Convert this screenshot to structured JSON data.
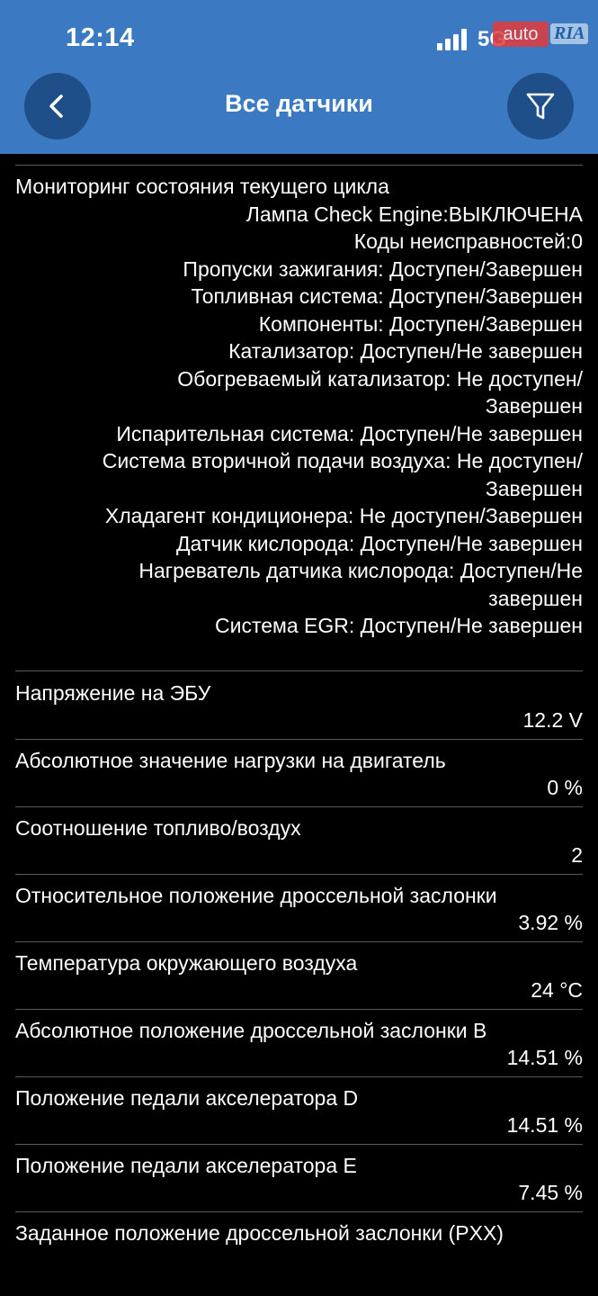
{
  "status_bar": {
    "time": "12:14",
    "network": "5G",
    "watermark_auto": "auto",
    "watermark_ria": "RIA"
  },
  "header": {
    "title": "Все датчики",
    "back_icon": "chevron-left-icon",
    "filter_icon": "filter-icon",
    "color": "#3b7ac2"
  },
  "monitor": {
    "title": "Мониторинг состояния текущего цикла",
    "lines": [
      "Лампа Check Engine:ВЫКЛЮЧЕНА",
      "Коды неисправностей:0",
      "Пропуски зажигания: Доступен/Завершен",
      "Топливная система: Доступен/Завершен",
      "Компоненты: Доступен/Завершен",
      "Катализатор: Доступен/Не завершен",
      "Обогреваемый катализатор: Не доступен/",
      "Завершен",
      "Испарительная система: Доступен/Не завершен",
      "Система вторичной подачи воздуха: Не доступен/",
      "Завершен",
      "Хладагент кондиционера: Не доступен/Завершен",
      "Датчик кислорода: Доступен/Не завершен",
      "Нагреватель датчика кислорода: Доступен/Не",
      "завершен",
      "Система EGR: Доступен/Не завершен"
    ]
  },
  "sensors": [
    {
      "label": "Напряжение на ЭБУ",
      "value": "12.2 V"
    },
    {
      "label": "Абсолютное значение нагрузки на двигатель",
      "value": "0 %"
    },
    {
      "label": "Соотношение топливо/воздух",
      "value": "2"
    },
    {
      "label": "Относительное положение дроссельной заслонки",
      "value": "3.92 %"
    },
    {
      "label": "Температура окружающего воздуха",
      "value": "24 °C"
    },
    {
      "label": "Абсолютное положение дроссельной заслонки B",
      "value": "14.51 %"
    },
    {
      "label": "Положение педали акселератора D",
      "value": "14.51 %"
    },
    {
      "label": "Положение педали акселератора E",
      "value": "7.45 %"
    },
    {
      "label": "Заданное положение дроссельной заслонки (PXX)",
      "value": ""
    }
  ]
}
